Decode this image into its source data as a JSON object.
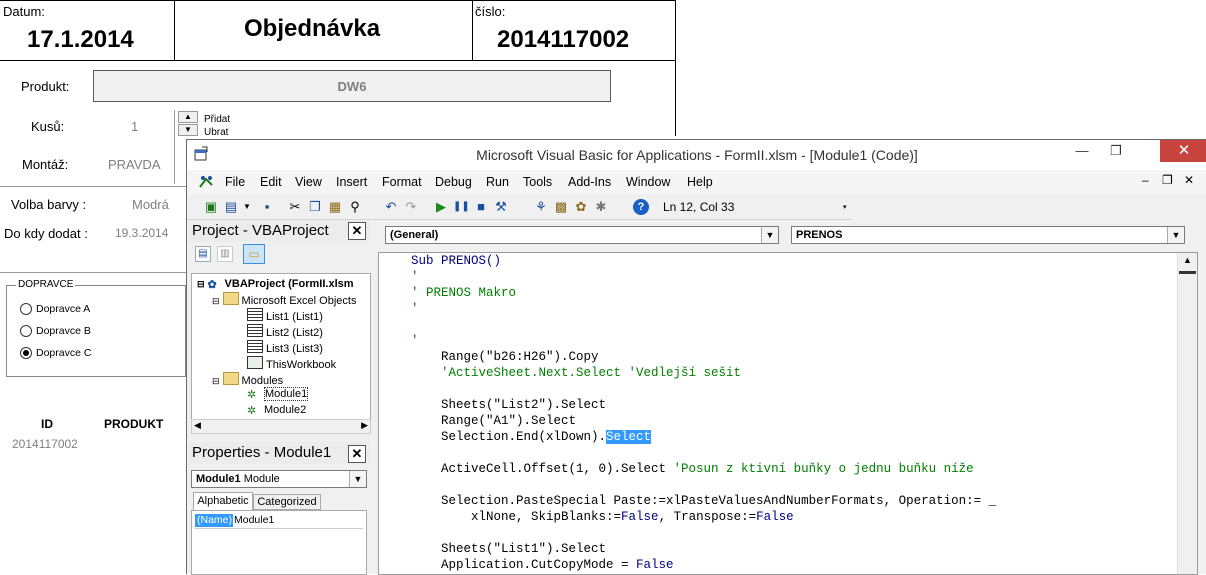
{
  "form": {
    "datum_label": "Datum:",
    "datum_value": "17.1.2014",
    "title": "Objednávka",
    "cislo_label": "číslo:",
    "cislo_value": "2014117002",
    "produkt_label": "Produkt:",
    "produkt_value": "DW6",
    "kusu_label": "Kusů:",
    "kusu_value": "1",
    "pridat_label": "Přidat",
    "ubrat_label": "Ubrat",
    "montaz_label": "Montáž:",
    "montaz_value": "PRAVDA",
    "barva_label": "Volba barvy :",
    "barva_value": "Modrá",
    "dodat_label": "Do kdy dodat :",
    "dodat_value": "19.3.2014",
    "dopravce_title": "DOPRAVCE",
    "dopravce_a": "Dopravce A",
    "dopravce_b": "Dopravce B",
    "dopravce_c": "Dopravce C",
    "dopravce_selected": "Dopravce C",
    "table_id_header": "ID",
    "table_produkt_header": "PRODUKT",
    "table_row_id": "2014117002"
  },
  "vba": {
    "window_title": "Microsoft Visual Basic for Applications - FormII.xlsm - [Module1 (Code)]",
    "menu": [
      "File",
      "Edit",
      "View",
      "Insert",
      "Format",
      "Debug",
      "Run",
      "Tools",
      "Add-Ins",
      "Window",
      "Help"
    ],
    "status_position": "Ln 12, Col 33",
    "project_title": "Project - VBAProject",
    "properties_title": "Properties - Module1",
    "tree": {
      "root": "VBAProject (FormII.xlsm",
      "excel_objects": "Microsoft Excel Objects",
      "list1": "List1 (List1)",
      "list2": "List2 (List2)",
      "list3": "List3 (List3)",
      "thisworkbook": "ThisWorkbook",
      "modules": "Modules",
      "module1": "Module1",
      "module2": "Module2"
    },
    "props_combo_name": "Module1",
    "props_combo_type": "Module",
    "tab_alphabetic": "Alphabetic",
    "tab_categorized": "Categorized",
    "prop_name_key": "(Name)",
    "prop_name_value": "Module1",
    "combo_general": "(General)",
    "combo_proc": "PRENOS",
    "code": {
      "l1": "Sub PRENOS()",
      "l2": "'",
      "l3": "' PRENOS Makro",
      "l4": "'",
      "l5": "'",
      "l6": "    Range(\"b26:H26\").Copy",
      "l7": "    'ActiveSheet.Next.Select 'Vedlejší sešit",
      "l8": "    Sheets(\"List2\").Select",
      "l9": "    Range(\"A1\").Select",
      "l10a": "    Selection.End(xlDown).",
      "l10b": "Select",
      "l11a": "    ActiveCell.Offset(1, 0).Select ",
      "l11b": "'Posun z ktivní buňky o jednu buňku níže",
      "l12": "    Selection.PasteSpecial Paste:=xlPasteValuesAndNumberFormats, Operation:= _",
      "l13a": "        xlNone, SkipBlanks:=",
      "l13b": "False",
      "l13c": ", Transpose:=",
      "l13d": "False",
      "l14": "    Sheets(\"List1\").Select",
      "l15a": "    Application.CutCopyMode = ",
      "l15b": "False"
    }
  }
}
